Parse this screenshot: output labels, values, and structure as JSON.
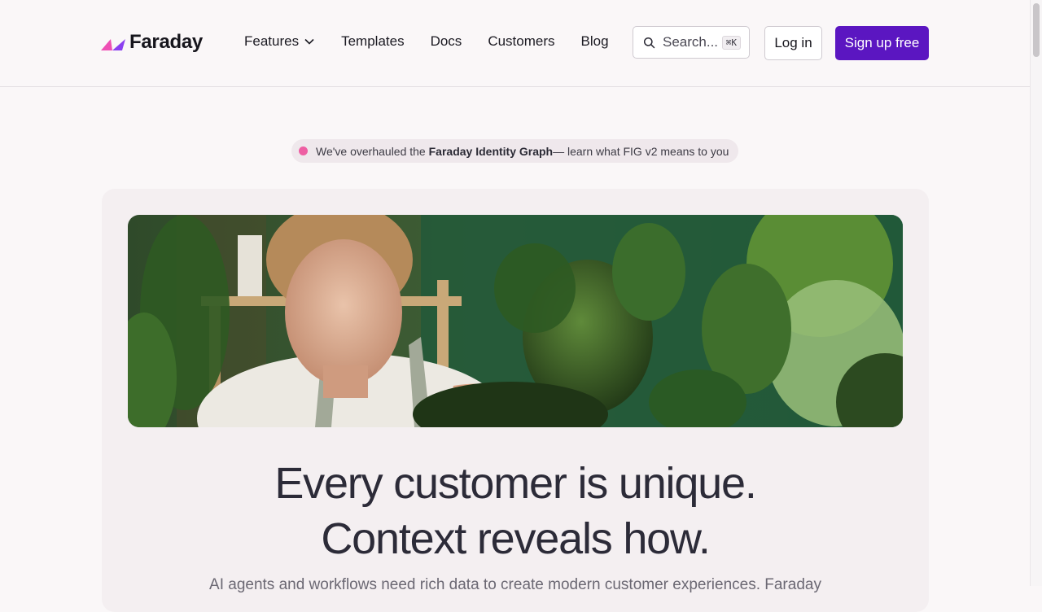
{
  "brand": {
    "name": "Faraday",
    "colors": {
      "accent": "#5b16c1",
      "logo_pink": "#ee4fb4",
      "logo_purple": "#8b3ff0",
      "dot": "#ee5fa3"
    }
  },
  "nav": {
    "items": [
      {
        "label": "Features",
        "has_dropdown": true,
        "icon": "chevron-down-icon"
      },
      {
        "label": "Templates"
      },
      {
        "label": "Docs"
      },
      {
        "label": "Customers"
      },
      {
        "label": "Blog"
      }
    ]
  },
  "search": {
    "placeholder": "Search...",
    "shortcut": "⌘K",
    "icon": "search-icon"
  },
  "auth": {
    "login_label": "Log in",
    "signup_label": "Sign up free"
  },
  "announcement": {
    "prefix": "We've overhauled the",
    "highlight": "Faraday Identity Graph",
    "suffix": " — learn what FIG v2 means to you"
  },
  "hero": {
    "image_alt": "Woman tending to potted plants",
    "headline_line1": "Every customer is unique.",
    "headline_line2": "Context reveals how.",
    "subtext": "AI agents and workflows need rich data to create modern customer experiences. Faraday"
  }
}
